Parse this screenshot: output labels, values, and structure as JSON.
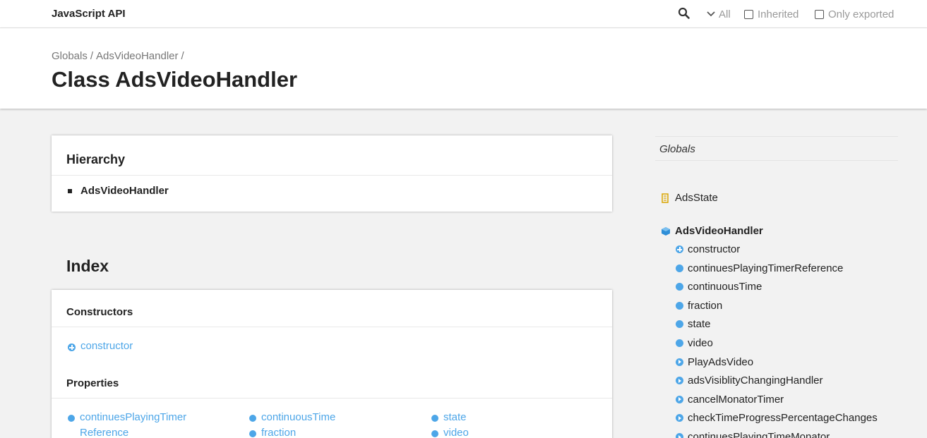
{
  "toolbar": {
    "title": "JavaScript API",
    "visibility_label": "All",
    "inherited_label": "Inherited",
    "exported_label": "Only exported"
  },
  "header": {
    "breadcrumb": [
      "Globals",
      "AdsVideoHandler"
    ],
    "separator": "/",
    "title": "Class AdsVideoHandler"
  },
  "hierarchy": {
    "title": "Hierarchy",
    "items": [
      "AdsVideoHandler"
    ]
  },
  "index": {
    "title": "Index",
    "constructors_title": "Constructors",
    "constructors": [
      "constructor"
    ],
    "properties_title": "Properties",
    "properties": [
      {
        "line1": "continuesPlayingTimer",
        "line2": "Reference"
      },
      {
        "line1": "continuousTime",
        "line2": ""
      },
      {
        "line1": "state",
        "line2": ""
      },
      {
        "line1": "fraction",
        "line2": ""
      },
      {
        "line1": "video",
        "line2": ""
      }
    ]
  },
  "sidebar": {
    "globals_label": "Globals",
    "enum_item": "AdsState",
    "class_item": "AdsVideoHandler",
    "members": [
      {
        "label": "constructor",
        "kind": "constructor"
      },
      {
        "label": "continuesPlayingTimerReference",
        "kind": "property"
      },
      {
        "label": "continuousTime",
        "kind": "property"
      },
      {
        "label": "fraction",
        "kind": "property"
      },
      {
        "label": "state",
        "kind": "property"
      },
      {
        "label": "video",
        "kind": "property"
      },
      {
        "label": "PlayAdsVideo",
        "kind": "method"
      },
      {
        "label": "adsVisiblityChangingHandler",
        "kind": "method"
      },
      {
        "label": "cancelMonatorTimer",
        "kind": "method"
      },
      {
        "label": "checkTimeProgressPercentageChanges",
        "kind": "method"
      },
      {
        "label": "continuesPlayingTimeMonator",
        "kind": "method"
      }
    ]
  },
  "colors": {
    "accent": "#4da6e8",
    "enum_icon": "#d9a400",
    "class_icon": "#2f8fd8"
  }
}
